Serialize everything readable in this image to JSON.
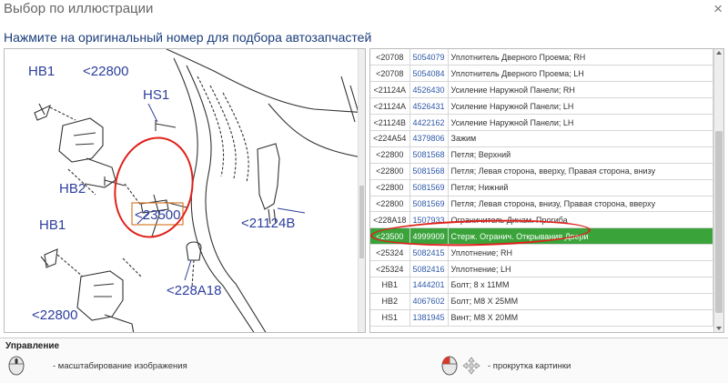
{
  "window": {
    "title": "Выбор по иллюстрации",
    "close_glyph": "×"
  },
  "instruction": "Нажмите на оригинальный номер для подбора автозапчастей",
  "illustration": {
    "callouts": [
      "HB1",
      "<22800",
      "HS1",
      "HB2",
      "<23500",
      "<21124B",
      "HB1",
      "<228A18",
      "<22800"
    ]
  },
  "parts": [
    {
      "ref": "<20708",
      "number": "5054079",
      "desc": "Уплотнитель Дверного Проема; RH"
    },
    {
      "ref": "<20708",
      "number": "5054084",
      "desc": "Уплотнитель Дверного Проема; LH"
    },
    {
      "ref": "<21124A",
      "number": "4526430",
      "desc": "Усиление Наружной Панели; RH"
    },
    {
      "ref": "<21124A",
      "number": "4526431",
      "desc": "Усиление Наружной Панели; LH"
    },
    {
      "ref": "<21124B",
      "number": "4422162",
      "desc": "Усиление Наружной Панели; LH"
    },
    {
      "ref": "<224A54",
      "number": "4379806",
      "desc": "Зажим"
    },
    {
      "ref": "<22800",
      "number": "5081568",
      "desc": "Петля; Верхний"
    },
    {
      "ref": "<22800",
      "number": "5081568",
      "desc": "Петля; Левая сторона, вверху, Правая сторона, внизу"
    },
    {
      "ref": "<22800",
      "number": "5081569",
      "desc": "Петля; Нижний"
    },
    {
      "ref": "<22800",
      "number": "5081569",
      "desc": "Петля; Левая сторона, внизу, Правая сторона, вверху"
    },
    {
      "ref": "<228A18",
      "number": "1507933",
      "desc": "Ограничитель Динам. Прогиба"
    },
    {
      "ref": "<23500",
      "number": "4999909",
      "desc": "Стерж. Огранич. Открывания Двери",
      "selected": true
    },
    {
      "ref": "<25324",
      "number": "5082415",
      "desc": "Уплотнение; RH"
    },
    {
      "ref": "<25324",
      "number": "5082416",
      "desc": "Уплотнение; LH"
    },
    {
      "ref": "HB1",
      "number": "1444201",
      "desc": "Болт; 8 x 11MM"
    },
    {
      "ref": "HB2",
      "number": "4067602",
      "desc": "Болт; M8 X 25MM"
    },
    {
      "ref": "HS1",
      "number": "1381945",
      "desc": "Винт; M8 X 20MM"
    }
  ],
  "controls": {
    "title": "Управление",
    "zoom_label": "- масштабирование изображения",
    "scroll_label": "- прокрутка картинки"
  },
  "colors": {
    "selected_row": "#3aa33a",
    "part_number_link": "#2f58a8",
    "callout_text": "#2d3f9e",
    "highlight_circle": "#e0201a"
  }
}
